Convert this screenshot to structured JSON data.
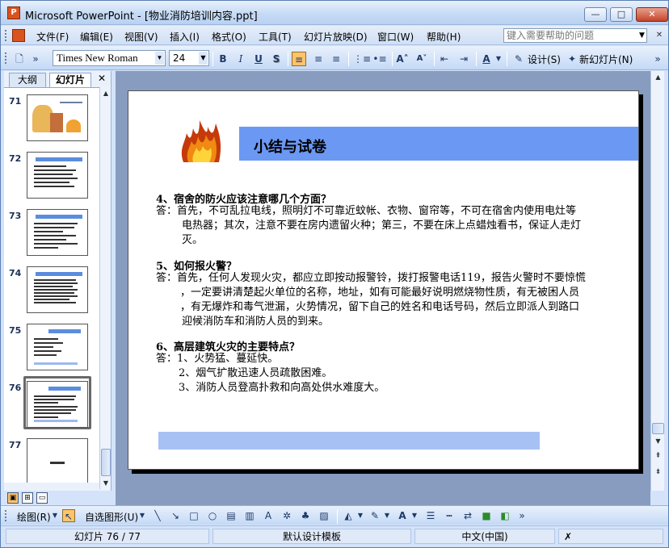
{
  "window": {
    "app_title": "Microsoft PowerPoint - [物业消防培训内容.ppt]",
    "min_glyph": "—",
    "max_glyph": "□",
    "close_glyph": "✕"
  },
  "menu": {
    "items": [
      "文件(F)",
      "编辑(E)",
      "视图(V)",
      "插入(I)",
      "格式(O)",
      "工具(T)",
      "幻灯片放映(D)",
      "窗口(W)",
      "帮助(H)"
    ],
    "help_placeholder": "键入需要帮助的问题"
  },
  "toolbar": {
    "font_name": "Times New Roman",
    "font_size": "24",
    "bold": "B",
    "italic": "I",
    "underline": "U",
    "shadow": "S",
    "design_label": "设计(S)",
    "new_slide_label": "新幻灯片(N)"
  },
  "left_pane": {
    "tabs": [
      "大纲",
      "幻灯片"
    ],
    "close_glyph": "✕",
    "slide_numbers": [
      "71",
      "72",
      "73",
      "74",
      "75",
      "76",
      "77"
    ],
    "selected_slide": "76"
  },
  "slide": {
    "title": "小结与试卷",
    "q4": "4、宿舍的防火应该注意哪几个方面？",
    "a4_l1": "答：首先，不可乱拉电线，照明灯不可靠近蚊帐、衣物、窗帘等，不可在宿舍内使用电灶等",
    "a4_l2": "电热器；其次，注意不要在房内遗留火种；第三，不要在床上点蜡烛看书，保证人走灯",
    "a4_l3": "灭。",
    "q5": "5、如何报火警？",
    "a5_l1": "答：首先，任何人发现火灾，都应立即按动报警铃，拨打报警电话119，报告火警时不要惊慌",
    "a5_l2": "，一定要讲清楚起火单位的名称，地址，如有可能最好说明燃烧物性质，有无被困人员",
    "a5_l3": "，有无爆炸和毒气泄漏，火势情况，留下自己的姓名和电话号码，然后立即派人到路口",
    "a5_l4": "迎候消防车和消防人员的到来。",
    "q6": "6、高层建筑火灾的主要特点？",
    "a6_l1": "答：1、火势猛、蔓延快。",
    "a6_l2": "2、烟气扩散迅速人员疏散困难。",
    "a6_l3": "3、消防人员登高扑救和向高处供水难度大。"
  },
  "drawbar": {
    "draw_label": "绘图(R)",
    "autoshape_label": "自选图形(U)"
  },
  "status": {
    "slide_pos": "幻灯片 76 / 77",
    "template": "默认设计模板",
    "language": "中文(中国)"
  },
  "colors": {
    "slide_title_bar": "#6b98f3",
    "slide_bottom_bar": "#a7c1f4",
    "office_blue": "#c3daf9"
  }
}
